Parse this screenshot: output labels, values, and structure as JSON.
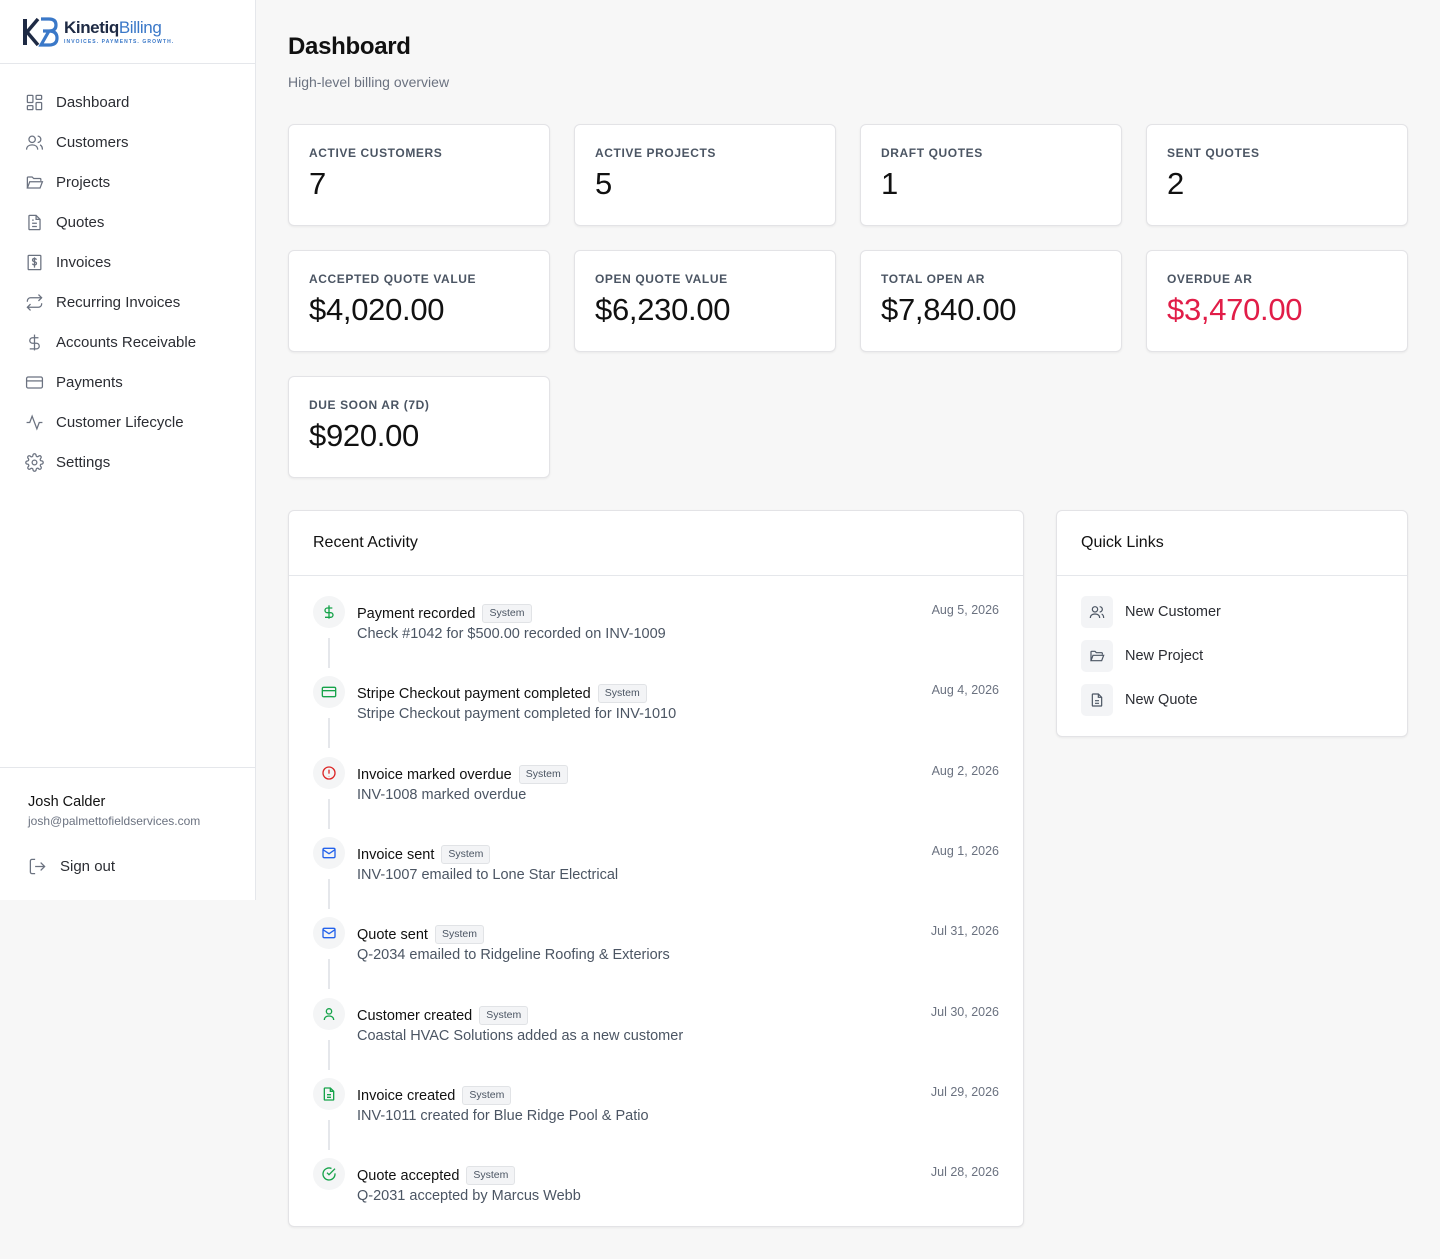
{
  "brand": {
    "name_part1": "Kinetiq",
    "name_part2": "Billing",
    "tagline": "INVOICES. PAYMENTS. GROWTH."
  },
  "nav": [
    {
      "label": "Dashboard",
      "icon": "grid-icon"
    },
    {
      "label": "Customers",
      "icon": "users-icon"
    },
    {
      "label": "Projects",
      "icon": "folder-icon"
    },
    {
      "label": "Quotes",
      "icon": "document-icon"
    },
    {
      "label": "Invoices",
      "icon": "invoice-icon"
    },
    {
      "label": "Recurring Invoices",
      "icon": "repeat-icon"
    },
    {
      "label": "Accounts Receivable",
      "icon": "dollar-icon"
    },
    {
      "label": "Payments",
      "icon": "credit-card-icon"
    },
    {
      "label": "Customer Lifecycle",
      "icon": "activity-icon"
    },
    {
      "label": "Settings",
      "icon": "gear-icon"
    }
  ],
  "user": {
    "name": "Josh Calder",
    "email": "josh@palmettofieldservices.com",
    "signout_label": "Sign out"
  },
  "page": {
    "title": "Dashboard",
    "subtitle": "High-level billing overview"
  },
  "stats": [
    {
      "label": "ACTIVE CUSTOMERS",
      "value": "7"
    },
    {
      "label": "ACTIVE PROJECTS",
      "value": "5"
    },
    {
      "label": "DRAFT QUOTES",
      "value": "1"
    },
    {
      "label": "SENT QUOTES",
      "value": "2"
    },
    {
      "label": "ACCEPTED QUOTE VALUE",
      "value": "$4,020.00"
    },
    {
      "label": "OPEN QUOTE VALUE",
      "value": "$6,230.00"
    },
    {
      "label": "TOTAL OPEN AR",
      "value": "$7,840.00"
    },
    {
      "label": "OVERDUE AR",
      "value": "$3,470.00"
    },
    {
      "label": "DUE SOON AR (7D)",
      "value": "$920.00"
    }
  ],
  "colors": {
    "overdue": "#e11d48",
    "green_icon": "#16a34a",
    "blue_icon": "#2563eb",
    "red_icon": "#dc2626",
    "brand_blue": "#3a78c8",
    "brand_navy": "#1e2a44"
  },
  "recent_activity": {
    "title": "Recent Activity",
    "items": [
      {
        "title": "Payment recorded",
        "badge": "System",
        "desc": "Check #1042 for $500.00 recorded on INV-1009",
        "date": "Aug 5, 2026",
        "icon": "dollar-icon"
      },
      {
        "title": "Stripe Checkout payment completed",
        "badge": "System",
        "desc": "Stripe Checkout payment completed for INV-1010",
        "date": "Aug 4, 2026",
        "icon": "credit-card-icon"
      },
      {
        "title": "Invoice marked overdue",
        "badge": "System",
        "desc": "INV-1008 marked overdue",
        "date": "Aug 2, 2026",
        "icon": "alert-circle-icon"
      },
      {
        "title": "Invoice sent",
        "badge": "System",
        "desc": "INV-1007 emailed to Lone Star Electrical",
        "date": "Aug 1, 2026",
        "icon": "mail-icon"
      },
      {
        "title": "Quote sent",
        "badge": "System",
        "desc": "Q-2034 emailed to Ridgeline Roofing & Exteriors",
        "date": "Jul 31, 2026",
        "icon": "mail-icon"
      },
      {
        "title": "Customer created",
        "badge": "System",
        "desc": "Coastal HVAC Solutions added as a new customer",
        "date": "Jul 30, 2026",
        "icon": "user-icon"
      },
      {
        "title": "Invoice created",
        "badge": "System",
        "desc": "INV-1011 created for Blue Ridge Pool & Patio",
        "date": "Jul 29, 2026",
        "icon": "file-text-icon"
      },
      {
        "title": "Quote accepted",
        "badge": "System",
        "desc": "Q-2031 accepted by Marcus Webb",
        "date": "Jul 28, 2026",
        "icon": "check-circle-icon"
      }
    ]
  },
  "quick_links": {
    "title": "Quick Links",
    "items": [
      {
        "label": "New Customer",
        "icon": "users-icon"
      },
      {
        "label": "New Project",
        "icon": "folder-icon"
      },
      {
        "label": "New Quote",
        "icon": "document-icon"
      }
    ]
  }
}
